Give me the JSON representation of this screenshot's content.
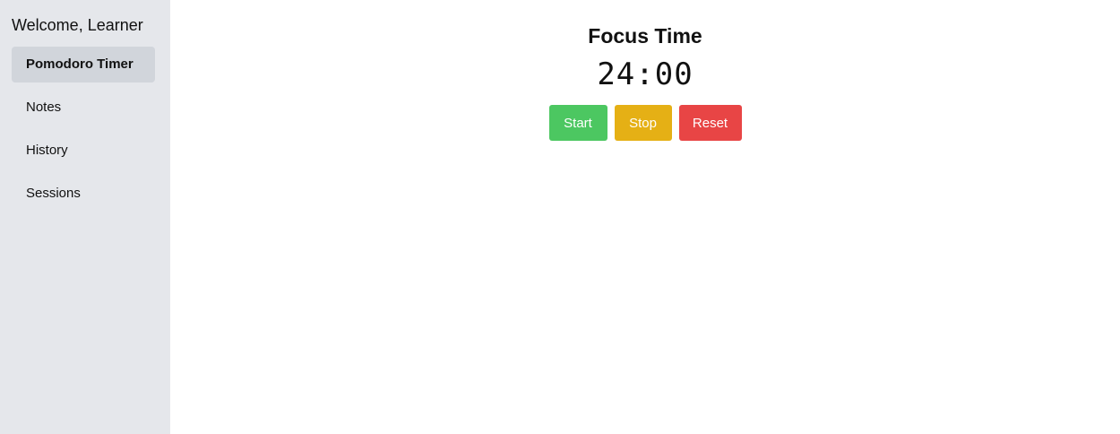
{
  "sidebar": {
    "welcome": "Welcome, Learner",
    "items": [
      {
        "label": "Pomodoro Timer",
        "active": true
      },
      {
        "label": "Notes",
        "active": false
      },
      {
        "label": "History",
        "active": false
      },
      {
        "label": "Sessions",
        "active": false
      }
    ]
  },
  "timer": {
    "title": "Focus Time",
    "display": "24:00",
    "buttons": {
      "start_label": "Start",
      "stop_label": "Stop",
      "reset_label": "Reset"
    }
  },
  "colors": {
    "sidebar_bg": "#e5e7eb",
    "active_item_bg": "#d1d5db",
    "start": "#4cc761",
    "stop": "#e5b015",
    "reset": "#e84545"
  }
}
